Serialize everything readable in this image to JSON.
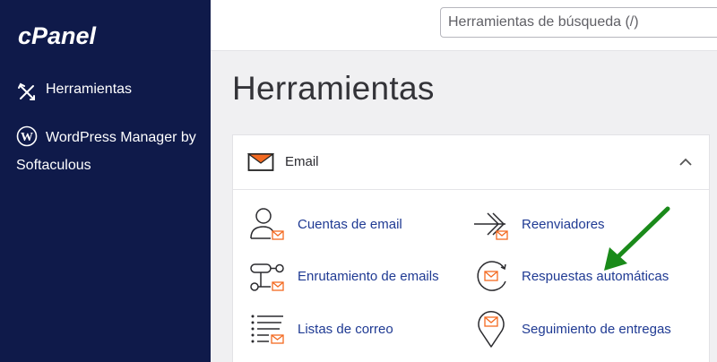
{
  "app": {
    "logo_text": "cPanel"
  },
  "colors": {
    "sidebar": "#0f1a4a",
    "link": "#1f3a93",
    "accent": "#f36a21",
    "annotation_arrow": "#1a8a1a"
  },
  "sidebar": {
    "items": [
      {
        "label": "Herramientas",
        "icon": "tools-icon"
      },
      {
        "label": "WordPress Manager by Softaculous",
        "icon": "wordpress-icon"
      }
    ]
  },
  "search": {
    "placeholder": "Herramientas de búsqueda (/)",
    "value": ""
  },
  "page": {
    "title": "Herramientas"
  },
  "email_section": {
    "title": "Email",
    "expanded": true,
    "tools": [
      {
        "label": "Cuentas de email",
        "icon": "email-accounts-icon"
      },
      {
        "label": "Reenviadores",
        "icon": "forwarders-icon"
      },
      {
        "label": "Enrutamiento de emails",
        "icon": "email-routing-icon"
      },
      {
        "label": "Respuestas automáticas",
        "icon": "autoresponders-icon"
      },
      {
        "label": "Listas de correo",
        "icon": "mailing-lists-icon"
      },
      {
        "label": "Seguimiento de entregas",
        "icon": "track-delivery-icon"
      }
    ]
  }
}
